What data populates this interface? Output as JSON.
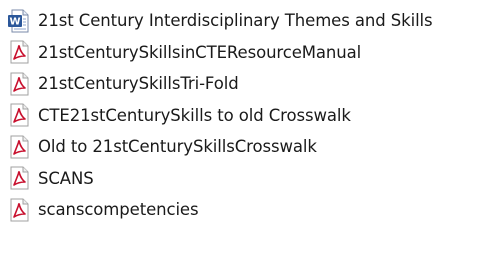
{
  "files": [
    {
      "name": "21st Century Interdisciplinary Themes and Skills",
      "icon": "word-document-icon"
    },
    {
      "name": "21stCenturySkillsinCTEResourceManual",
      "icon": "pdf-icon"
    },
    {
      "name": "21stCenturySkillsTri-Fold",
      "icon": "pdf-icon"
    },
    {
      "name": "CTE21stCenturySkills to old Crosswalk",
      "icon": "pdf-icon"
    },
    {
      "name": "Old to 21stCenturySkillsCrosswalk",
      "icon": "pdf-icon"
    },
    {
      "name": "SCANS",
      "icon": "pdf-icon"
    },
    {
      "name": "scanscompetencies",
      "icon": "pdf-icon"
    }
  ],
  "colors": {
    "pdf_red": "#c8102e",
    "word_blue": "#2b579a",
    "text": "#1a1a1a"
  }
}
